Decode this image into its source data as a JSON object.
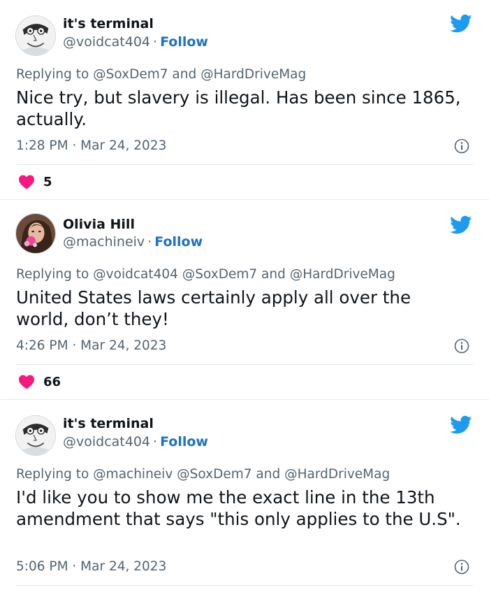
{
  "tweets": [
    {
      "name": "it's terminal",
      "handle": "@voidcat404",
      "follow": "Follow",
      "replying": "Replying to @SoxDem7 and @HardDriveMag",
      "text": "Nice try, but slavery is illegal. Has been since 1865, actually.",
      "meta": "1:28 PM · Mar 24, 2023",
      "likes": "5"
    },
    {
      "name": "Olivia Hill",
      "handle": "@machineiv",
      "follow": "Follow",
      "replying": "Replying to @voidcat404 @SoxDem7 and @HardDriveMag",
      "text": "United States laws certainly apply all over the world, don’t they!",
      "meta": "4:26 PM · Mar 24, 2023",
      "likes": "66"
    },
    {
      "name": "it's terminal",
      "handle": "@voidcat404",
      "follow": "Follow",
      "replying": "Replying to @machineiv @SoxDem7 and @HardDriveMag",
      "text": "I'd like you to show me the exact line in the 13th amendment that says \"this only applies to the U.S\".",
      "meta": "5:06 PM · Mar 24, 2023"
    }
  ],
  "colors": {
    "twitter_blue": "#1d9bf0",
    "follow_blue": "#1d72c4",
    "heart_pink": "#f91880",
    "muted_text": "#536471"
  },
  "icons": {
    "brand": "twitter-bird-icon",
    "info": "info-icon",
    "like": "heart-icon"
  }
}
